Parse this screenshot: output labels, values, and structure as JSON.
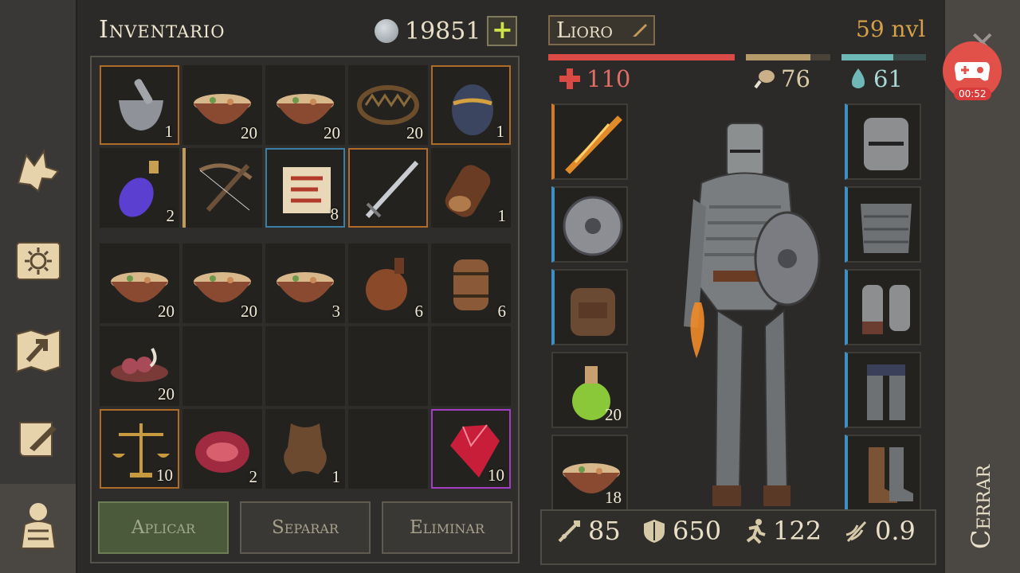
{
  "inventory": {
    "title": "Inventario",
    "currency_value": "19851",
    "add_currency_label": "+",
    "slots": [
      {
        "name": "mortar-and-pestle",
        "count": "1"
      },
      {
        "name": "stew-bowl",
        "count": "20"
      },
      {
        "name": "stew-bowl",
        "count": "20"
      },
      {
        "name": "bear-trap",
        "count": "20"
      },
      {
        "name": "egg",
        "count": "1"
      },
      {
        "name": "mana-potion",
        "count": "2"
      },
      {
        "name": "crossbow",
        "count": ""
      },
      {
        "name": "map-scroll",
        "count": "8"
      },
      {
        "name": "longsword",
        "count": ""
      },
      {
        "name": "log",
        "count": "1"
      },
      {
        "name": "stew-bowl",
        "count": "20"
      },
      {
        "name": "stew-bowl",
        "count": "20"
      },
      {
        "name": "stew-bowl",
        "count": "3"
      },
      {
        "name": "flask",
        "count": "6"
      },
      {
        "name": "barrel",
        "count": "6"
      },
      {
        "name": "meat-bowl",
        "count": "20"
      },
      {
        "name": "empty",
        "count": ""
      },
      {
        "name": "empty",
        "count": ""
      },
      {
        "name": "empty",
        "count": ""
      },
      {
        "name": "empty",
        "count": ""
      },
      {
        "name": "scales",
        "count": "10"
      },
      {
        "name": "raw-steak",
        "count": "2"
      },
      {
        "name": "leather-hide",
        "count": "1"
      },
      {
        "name": "empty",
        "count": ""
      },
      {
        "name": "red-gem",
        "count": "10"
      }
    ]
  },
  "actions": {
    "apply": "Aplicar",
    "split": "Separar",
    "delete": "Eliminar"
  },
  "character": {
    "name": "Lioro",
    "level": "59 nvl",
    "health": "110",
    "food": "76",
    "water": "61",
    "health_fill": 1.0,
    "food_fill": 0.76,
    "water_fill": 0.61,
    "equip_left": [
      {
        "name": "flaming-sword",
        "count": ""
      },
      {
        "name": "round-shield",
        "count": ""
      },
      {
        "name": "backpack",
        "count": ""
      },
      {
        "name": "green-potion",
        "count": "20"
      },
      {
        "name": "stew-bowl",
        "count": "18"
      }
    ],
    "equip_right": [
      "helmet",
      "chain-armor",
      "gauntlets",
      "leg-armor",
      "boots"
    ],
    "attack": "85",
    "defense": "650",
    "speed": "122",
    "attack_speed": "0.9"
  },
  "close_label": "Cerrar",
  "record_time": "00:52",
  "colors": {
    "health": "#d94a44",
    "food": "#b59a6a",
    "water": "#6fb8b8",
    "level": "#d4a04a",
    "accent_green": "#cde34a"
  }
}
